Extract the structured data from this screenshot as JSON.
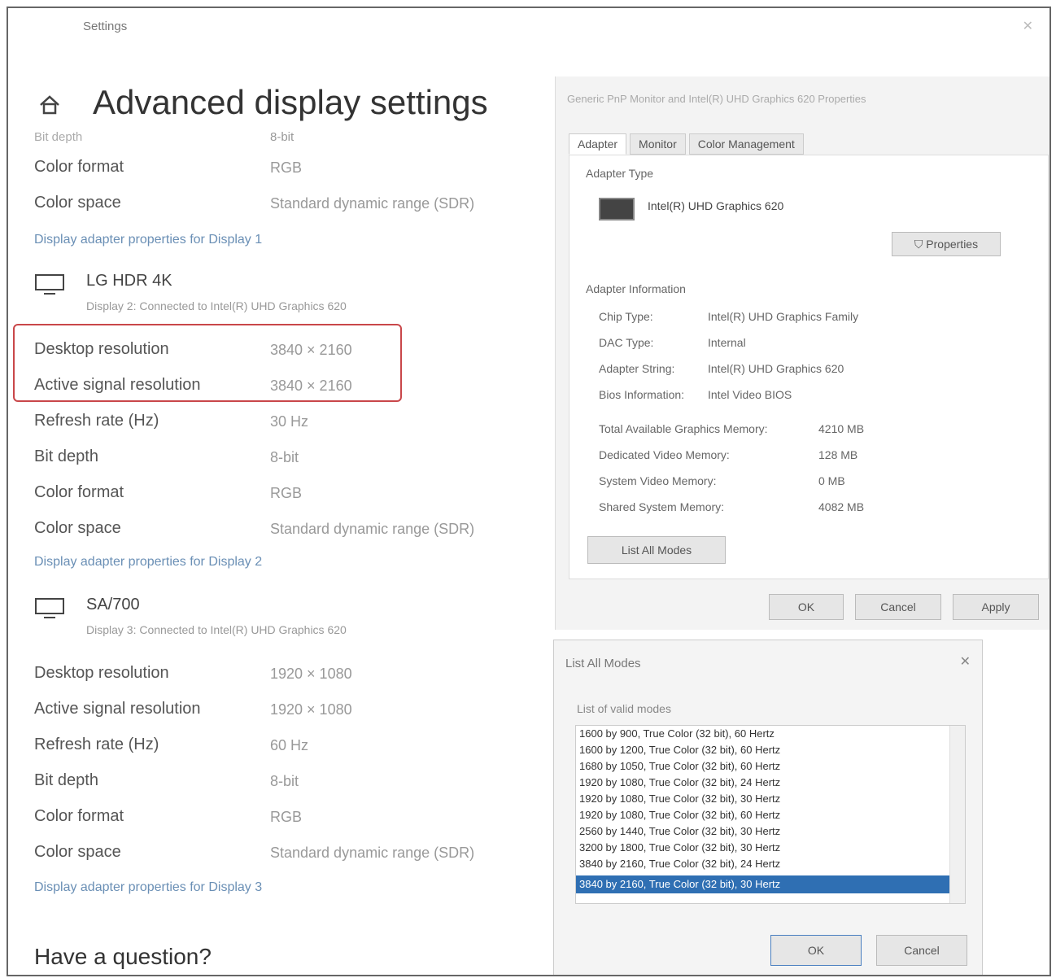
{
  "window": {
    "title": "Settings"
  },
  "page": {
    "title": "Advanced display settings"
  },
  "display0": {
    "partial_row": {
      "label": "Bit depth",
      "value": "8-bit"
    },
    "rows": [
      {
        "label": "Color format",
        "value": "RGB"
      },
      {
        "label": "Color space",
        "value": "Standard dynamic range (SDR)"
      }
    ],
    "link": "Display adapter properties for Display 1"
  },
  "display1": {
    "name": "LG HDR 4K",
    "sub": "Display 2: Connected to Intel(R) UHD Graphics 620",
    "rows": [
      {
        "label": "Desktop resolution",
        "value": "3840 × 2160"
      },
      {
        "label": "Active signal resolution",
        "value": "3840 × 2160"
      },
      {
        "label": "Refresh rate (Hz)",
        "value": "30 Hz"
      },
      {
        "label": "Bit depth",
        "value": "8-bit"
      },
      {
        "label": "Color format",
        "value": "RGB"
      },
      {
        "label": "Color space",
        "value": "Standard dynamic range (SDR)"
      }
    ],
    "link": "Display adapter properties for Display 2"
  },
  "display2": {
    "name": "SA/700",
    "sub": "Display 3: Connected to Intel(R) UHD Graphics 620",
    "rows": [
      {
        "label": "Desktop resolution",
        "value": "1920 × 1080"
      },
      {
        "label": "Active signal resolution",
        "value": "1920 × 1080"
      },
      {
        "label": "Refresh rate (Hz)",
        "value": "60 Hz"
      },
      {
        "label": "Bit depth",
        "value": "8-bit"
      },
      {
        "label": "Color format",
        "value": "RGB"
      },
      {
        "label": "Color space",
        "value": "Standard dynamic range (SDR)"
      }
    ],
    "link": "Display adapter properties for Display 3"
  },
  "question": "Have a question?",
  "adapter": {
    "title": "Generic PnP Monitor and Intel(R) UHD Graphics 620 Properties",
    "tabs": [
      "Adapter",
      "Monitor",
      "Color Management"
    ],
    "adapter_type_label": "Adapter Type",
    "adapter_name": "Intel(R) UHD Graphics 620",
    "properties_button": "Properties",
    "info_label": "Adapter Information",
    "info": [
      {
        "k": "Chip Type:",
        "v": "Intel(R) UHD Graphics Family"
      },
      {
        "k": "DAC Type:",
        "v": "Internal"
      },
      {
        "k": "Adapter String:",
        "v": "Intel(R) UHD Graphics 620"
      },
      {
        "k": "Bios Information:",
        "v": "Intel Video BIOS"
      }
    ],
    "memory": [
      {
        "k": "Total Available Graphics Memory:",
        "v": "4210 MB"
      },
      {
        "k": "Dedicated Video Memory:",
        "v": "128 MB"
      },
      {
        "k": "System Video Memory:",
        "v": "0 MB"
      },
      {
        "k": "Shared System Memory:",
        "v": "4082 MB"
      }
    ],
    "list_modes_button": "List All Modes",
    "ok": "OK",
    "cancel": "Cancel",
    "apply": "Apply"
  },
  "list_modes": {
    "title": "List All Modes",
    "label": "List of valid modes",
    "items": [
      "1600 by 900, True Color (32 bit), 60 Hertz",
      "1600 by 1200, True Color (32 bit), 60 Hertz",
      "1680 by 1050, True Color (32 bit), 60 Hertz",
      "1920 by 1080, True Color (32 bit), 24 Hertz",
      "1920 by 1080, True Color (32 bit), 30 Hertz",
      "1920 by 1080, True Color (32 bit), 60 Hertz",
      "2560 by 1440, True Color (32 bit), 30 Hertz",
      "3200 by 1800, True Color (32 bit), 30 Hertz",
      "3840 by 2160, True Color (32 bit), 24 Hertz"
    ],
    "selected": "3840 by 2160, True Color (32 bit), 30 Hertz",
    "ok": "OK",
    "cancel": "Cancel"
  }
}
